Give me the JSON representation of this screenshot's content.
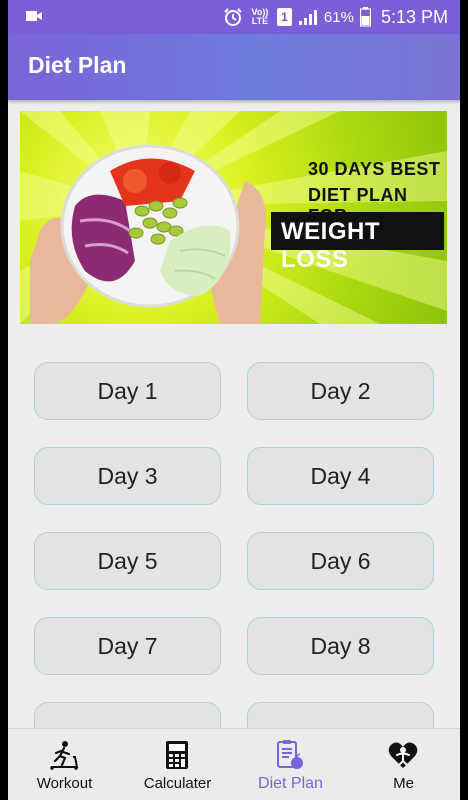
{
  "status_bar": {
    "battery": "61%",
    "time": "5:13 PM",
    "volte": "Vo)) LTE",
    "sim": "1"
  },
  "app_bar": {
    "title": "Diet Plan"
  },
  "banner": {
    "line1": "30 DAYS  BEST",
    "line2": "DIET PLAN FOR",
    "highlight": "WEIGHT LOSS"
  },
  "days": [
    "Day 1",
    "Day 2",
    "Day 3",
    "Day 4",
    "Day 5",
    "Day 6",
    "Day 7",
    "Day 8",
    "",
    ""
  ],
  "bottom_nav": {
    "items": [
      {
        "label": "Workout",
        "icon": "treadmill-icon"
      },
      {
        "label": "Calculater",
        "icon": "calculator-icon"
      },
      {
        "label": "Diet Plan",
        "icon": "diet-chart-icon",
        "active": true
      },
      {
        "label": "Me",
        "icon": "heart-person-icon"
      }
    ]
  },
  "colors": {
    "accent": "#7a63d8",
    "button_border": "#a8d6d8",
    "button_bg": "#e3e3e3"
  }
}
